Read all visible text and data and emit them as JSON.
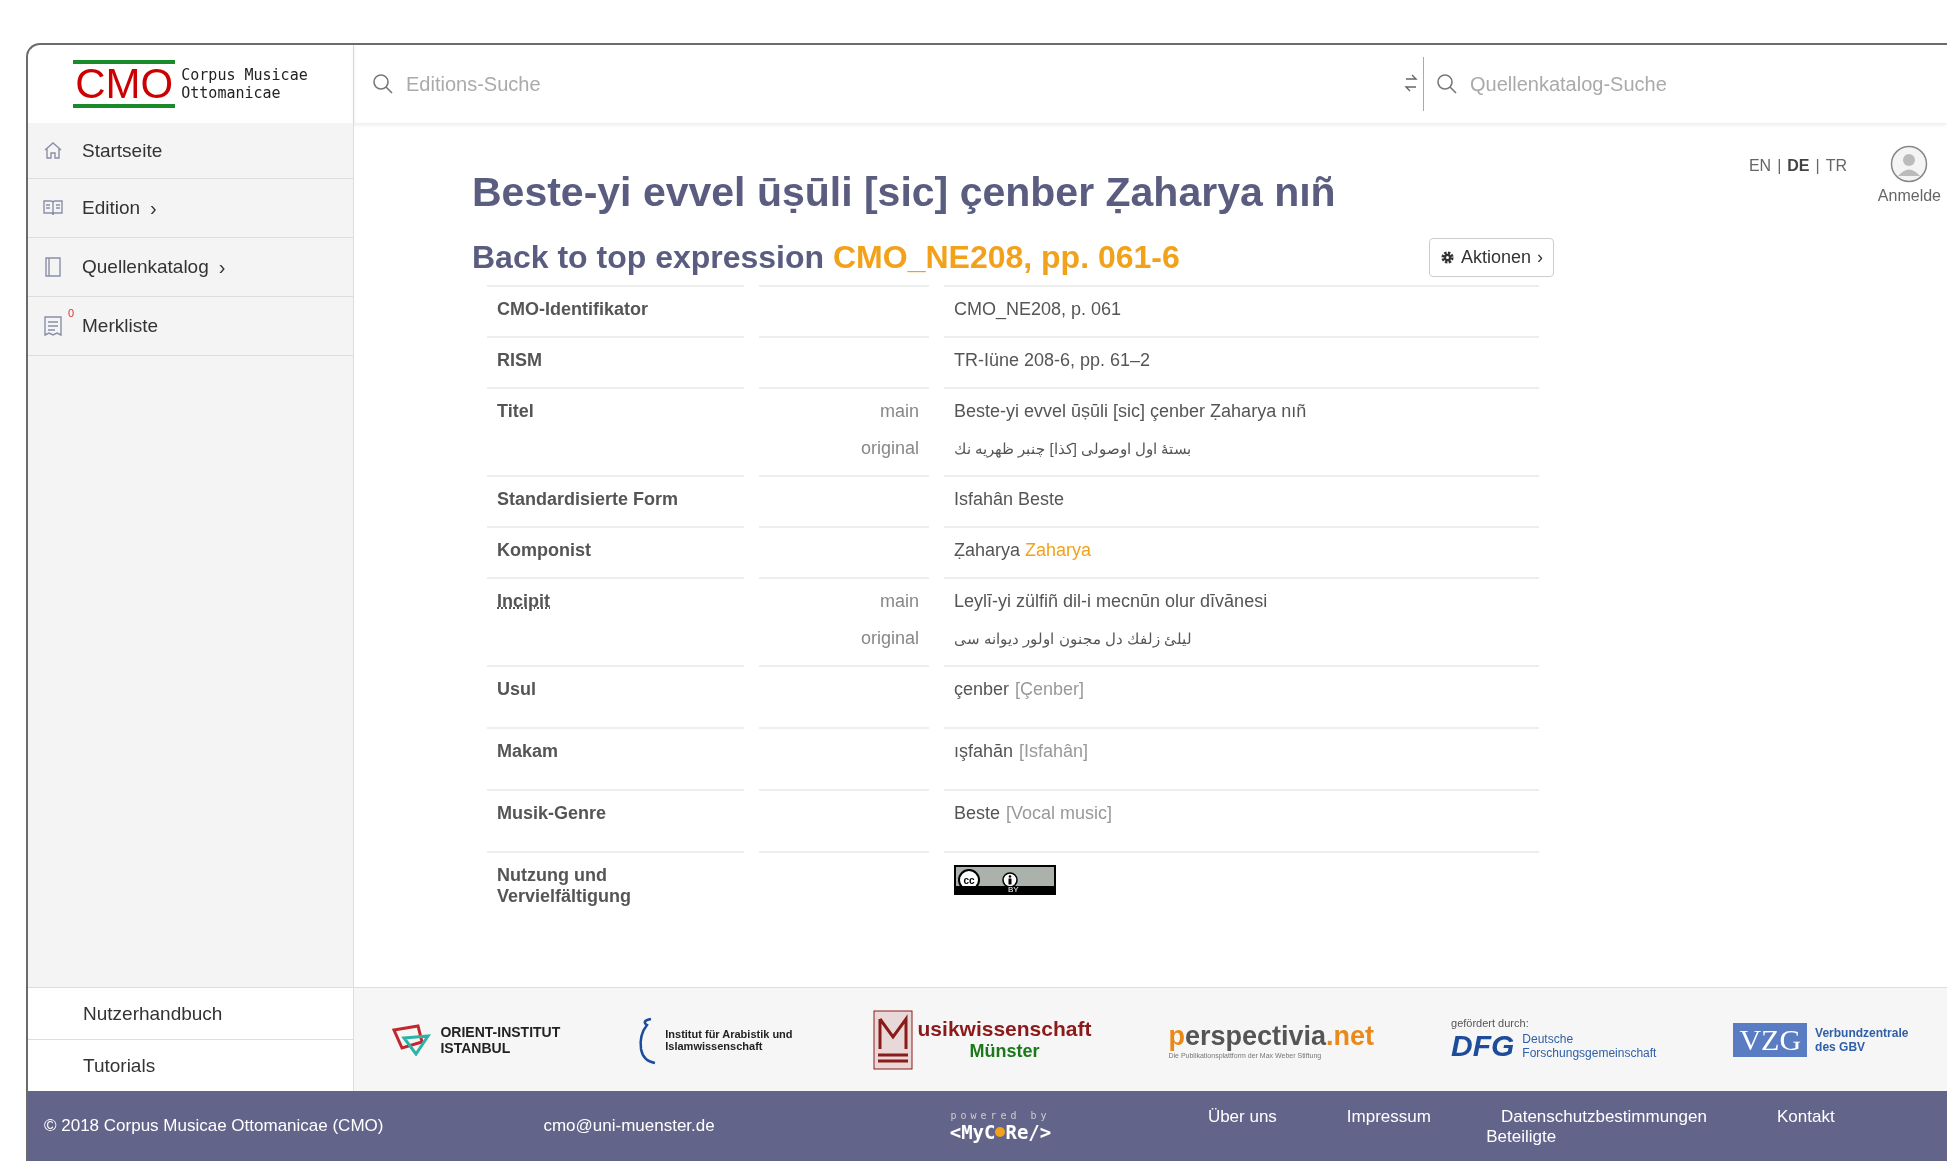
{
  "logo": {
    "mark": "CMO",
    "line1": "Corpus Musicae",
    "line2": "Ottomanicae"
  },
  "search": [
    {
      "placeholder": "Editions-Suche"
    },
    {
      "placeholder": "Quellenkatalog-Suche"
    }
  ],
  "sidebar": {
    "items": [
      {
        "kind": "home",
        "label": "Startseite"
      },
      {
        "kind": "book",
        "label": "Edition",
        "chevron": "›"
      },
      {
        "kind": "catalog",
        "label": "Quellenkatalog",
        "chevron": "›"
      },
      {
        "kind": "list",
        "label": "Merkliste",
        "badge": "0"
      }
    ],
    "bottom": [
      "Nutzerhandbuch",
      "Tutorials"
    ]
  },
  "language_separator": "|",
  "languages": [
    {
      "label": "EN",
      "selected": false
    },
    {
      "label": "DE",
      "selected": true
    },
    {
      "label": "TR",
      "selected": false
    }
  ],
  "user": {
    "label": "Anmelde"
  },
  "title": "Beste-yi evvel ūṣūli [sic] çenber Ẓaharya nıñ",
  "subtitle": {
    "text": "Back to top expression",
    "link": "CMO_NE208, pp. 061-6"
  },
  "actions_button": {
    "label": "Aktionen",
    "chevron": "›"
  },
  "rows": [
    {
      "label": "CMO-Identifikator",
      "entries": [
        {
          "value": "CMO_NE208, p. 061"
        }
      ]
    },
    {
      "label": "RISM",
      "entries": [
        {
          "value": "TR-Iüne 208-6, pp. 61–2"
        }
      ]
    },
    {
      "label": "Titel",
      "entries": [
        {
          "qualifier": "main",
          "value": "Beste-yi evvel ūṣūli [sic] çenber Ẓaharya nıñ"
        },
        {
          "qualifier": "original",
          "value": "بستهٔ اول اوصولی [كذا] چنبر ظهریه نك",
          "rtl": true
        }
      ]
    },
    {
      "label": "Standardisierte Form",
      "entries": [
        {
          "value": "Isfahân Beste"
        }
      ]
    },
    {
      "label": "Komponist",
      "entries": [
        {
          "value": "Ẓaharya",
          "link": "Zaharya"
        }
      ]
    },
    {
      "label": "Incipit",
      "abbr": true,
      "entries": [
        {
          "qualifier": "main",
          "value": "Leylī-yi zülfiñ dil-i mecnūn olur dīvānesi"
        },
        {
          "qualifier": "original",
          "value": "ليلئ زلفك دل مجنون اولور ديوانه سى",
          "rtl": true
        }
      ]
    },
    {
      "label": "Usul",
      "tall": true,
      "entries": [
        {
          "value": "çenber",
          "note": "[Çenber]"
        }
      ]
    },
    {
      "label": "Makam",
      "tall": true,
      "entries": [
        {
          "value": "ışfahān",
          "note": "[Isfahân]"
        }
      ]
    },
    {
      "label": "Musik-Genre",
      "tall": true,
      "entries": [
        {
          "value": "Beste",
          "note": "[Vocal music]"
        }
      ]
    },
    {
      "label": "Nutzung und Vervielfältigung",
      "license": {
        "cc": "cc",
        "by": "BY"
      }
    }
  ],
  "partners": [
    {
      "kind": "orient",
      "lines": [
        "ORIENT-INSTITUT",
        "ISTANBUL"
      ]
    },
    {
      "kind": "arabistik",
      "lines": [
        "Institut für Arabistik und",
        "Islamwissenschaft"
      ]
    },
    {
      "kind": "musik",
      "lines": [
        "usikwissenschaft",
        "Münster"
      ]
    },
    {
      "kind": "perspectivia",
      "lines": [
        "perspectivia.net",
        "Die Publikationsplattform der Max Weber Stiftung"
      ]
    },
    {
      "kind": "dfg",
      "lines": [
        "gefördert durch:",
        "DFG",
        "Deutsche",
        "Forschungsgemeinschaft"
      ]
    },
    {
      "kind": "vzg",
      "lines": [
        "VZG",
        "Verbundzentrale",
        "des GBV"
      ]
    }
  ],
  "footer": {
    "copyright": "© 2018 Corpus Musicae Ottomanicae (CMO)",
    "email": "cmo@uni-muenster.de",
    "powered": "powered by",
    "mycore": [
      "<MyC",
      "Re/>"
    ],
    "links": [
      "Über uns",
      "Impressum",
      "Datenschutzbestimmungen",
      "Kontakt",
      "Beteiligte"
    ]
  }
}
